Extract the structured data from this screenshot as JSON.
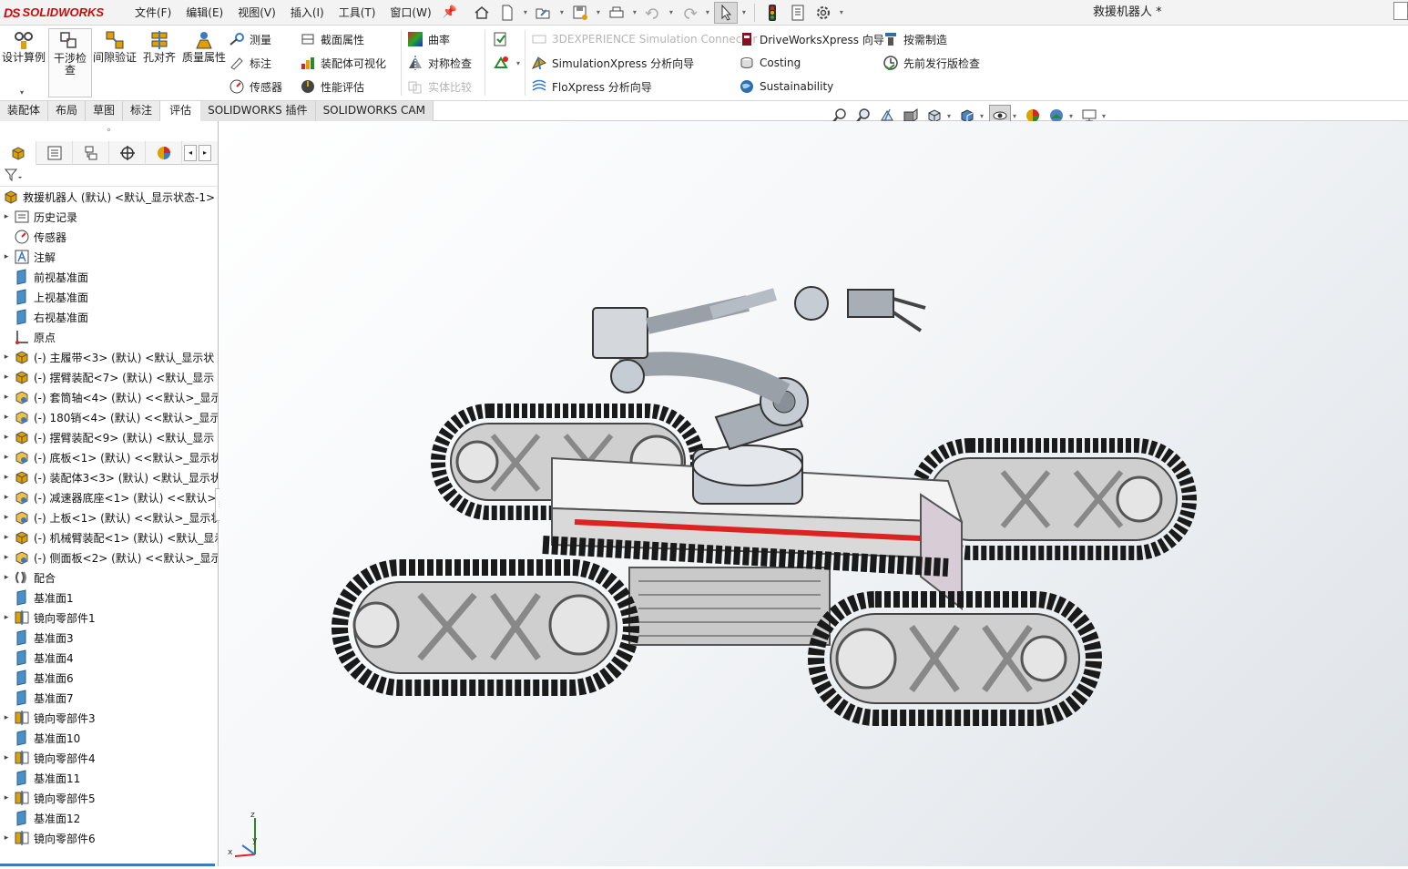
{
  "app": {
    "logo_prefix": "DS",
    "logo_solid": "SOLID",
    "logo_works": "WORKS",
    "doc_title": "救援机器人 *",
    "accent_color": "#cc0a0a",
    "selection_color": "#3a79c4"
  },
  "menu": [
    "文件(F)",
    "编辑(E)",
    "视图(V)",
    "插入(I)",
    "工具(T)",
    "窗口(W)"
  ],
  "ribbon": {
    "big_buttons": [
      {
        "label": "设计算例"
      },
      {
        "label": "干涉检查"
      },
      {
        "label": "间隙验证"
      },
      {
        "label": "孔对齐"
      },
      {
        "label": "质量属性"
      }
    ],
    "small_buttons": {
      "measure": "测量",
      "markup": "标注",
      "sensor": "传感器",
      "section_props": "截面属性",
      "assembly_vis": "装配体可视化",
      "perf_eval": "性能评估",
      "curvature": "曲率",
      "symmetry": "对称检查",
      "compare": "实体比较",
      "sim_connector": "3DEXPERIENCE Simulation Connector",
      "simxpress": "SimulationXpress 分析向导",
      "floxpress": "FloXpress 分析向导",
      "driveworks": "DriveWorksXpress 向导",
      "costing": "Costing",
      "sustainability": "Sustainability",
      "on_demand": "按需制造",
      "release_check": "先前发行版检查"
    }
  },
  "tabs": [
    "装配体",
    "布局",
    "草图",
    "标注",
    "评估",
    "SOLIDWORKS 插件",
    "SOLIDWORKS CAM"
  ],
  "active_tab": "评估",
  "tree": {
    "root": "救援机器人 (默认) <默认_显示状态-1>",
    "items": [
      {
        "label": "历史记录",
        "icon": "history-icon",
        "exp": true
      },
      {
        "label": "传感器",
        "icon": "sensor-icon",
        "exp": false
      },
      {
        "label": "注解",
        "icon": "annotation-icon",
        "exp": true
      },
      {
        "label": "前视基准面",
        "icon": "plane-icon",
        "exp": false
      },
      {
        "label": "上视基准面",
        "icon": "plane-icon",
        "exp": false
      },
      {
        "label": "右视基准面",
        "icon": "plane-icon",
        "exp": false
      },
      {
        "label": "原点",
        "icon": "origin-icon",
        "exp": false
      },
      {
        "label": "(-) 主履带<3> (默认) <默认_显示状",
        "icon": "subassembly-icon",
        "exp": true
      },
      {
        "label": "(-) 摆臂装配<7> (默认) <默认_显示",
        "icon": "subassembly-icon",
        "exp": true
      },
      {
        "label": "(-) 套筒轴<4> (默认) <<默认>_显示",
        "icon": "part-icon",
        "exp": true
      },
      {
        "label": "(-) 180销<4> (默认) <<默认>_显示",
        "icon": "part-icon",
        "exp": true
      },
      {
        "label": "(-) 摆臂装配<9> (默认) <默认_显示",
        "icon": "subassembly-icon",
        "exp": true
      },
      {
        "label": "(-) 底板<1> (默认) <<默认>_显示状",
        "icon": "part-icon",
        "exp": true
      },
      {
        "label": "(-) 装配体3<3> (默认) <默认_显示状",
        "icon": "subassembly-icon",
        "exp": true
      },
      {
        "label": "(-) 减速器底座<1> (默认) <<默认>_显",
        "icon": "part-icon",
        "exp": true
      },
      {
        "label": "(-) 上板<1> (默认) <<默认>_显示状态",
        "icon": "part-icon",
        "exp": true
      },
      {
        "label": "(-) 机械臂装配<1> (默认) <默认_显示",
        "icon": "subassembly-icon",
        "exp": true
      },
      {
        "label": "(-) 侧面板<2> (默认) <<默认>_显示",
        "icon": "part-icon",
        "exp": true
      },
      {
        "label": "配合",
        "icon": "mates-icon",
        "exp": true
      },
      {
        "label": "基准面1",
        "icon": "plane-icon",
        "exp": false
      },
      {
        "label": "镜向零部件1",
        "icon": "mirror-icon",
        "exp": true
      },
      {
        "label": "基准面3",
        "icon": "plane-icon",
        "exp": false
      },
      {
        "label": "基准面4",
        "icon": "plane-icon",
        "exp": false
      },
      {
        "label": "基准面6",
        "icon": "plane-icon",
        "exp": false
      },
      {
        "label": "基准面7",
        "icon": "plane-icon",
        "exp": false
      },
      {
        "label": "镜向零部件3",
        "icon": "mirror-icon",
        "exp": true
      },
      {
        "label": "基准面10",
        "icon": "plane-icon",
        "exp": false
      },
      {
        "label": "镜向零部件4",
        "icon": "mirror-icon",
        "exp": true
      },
      {
        "label": "基准面11",
        "icon": "plane-icon",
        "exp": false
      },
      {
        "label": "镜向零部件5",
        "icon": "mirror-icon",
        "exp": true
      },
      {
        "label": "基准面12",
        "icon": "plane-icon",
        "exp": false
      },
      {
        "label": "镜向零部件6",
        "icon": "mirror-icon",
        "exp": true
      }
    ]
  },
  "triad": {
    "z": "z",
    "y": "y",
    "x": "x"
  }
}
